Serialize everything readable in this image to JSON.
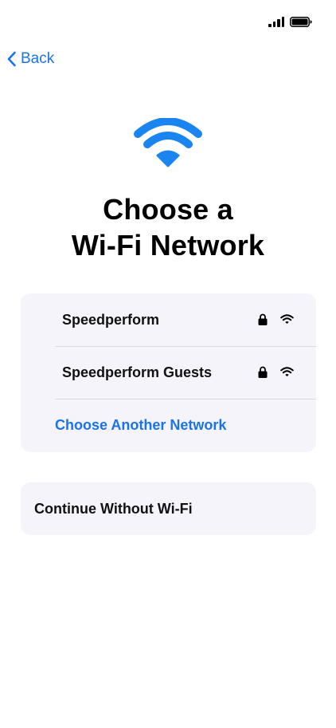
{
  "status_bar": {
    "icons": [
      "signal-icon",
      "battery-icon"
    ]
  },
  "nav": {
    "back_label": "Back",
    "back_icon": "chevron-left-icon"
  },
  "hero": {
    "icon": "wifi-icon",
    "title_line1": "Choose a",
    "title_line2": "Wi-Fi Network"
  },
  "networks": [
    {
      "name": "Speedperform",
      "secured": true,
      "icons": [
        "lock-icon",
        "wifi-icon"
      ]
    },
    {
      "name": "Speedperform Guests",
      "secured": true,
      "icons": [
        "lock-icon",
        "wifi-icon"
      ]
    }
  ],
  "choose_another_label": "Choose Another Network",
  "continue_label": "Continue Without Wi-Fi",
  "colors": {
    "accent": "#1a73e8",
    "wifi_hero": "#1a85f0",
    "card_background": "#f4f4fa",
    "text": "#111111"
  }
}
